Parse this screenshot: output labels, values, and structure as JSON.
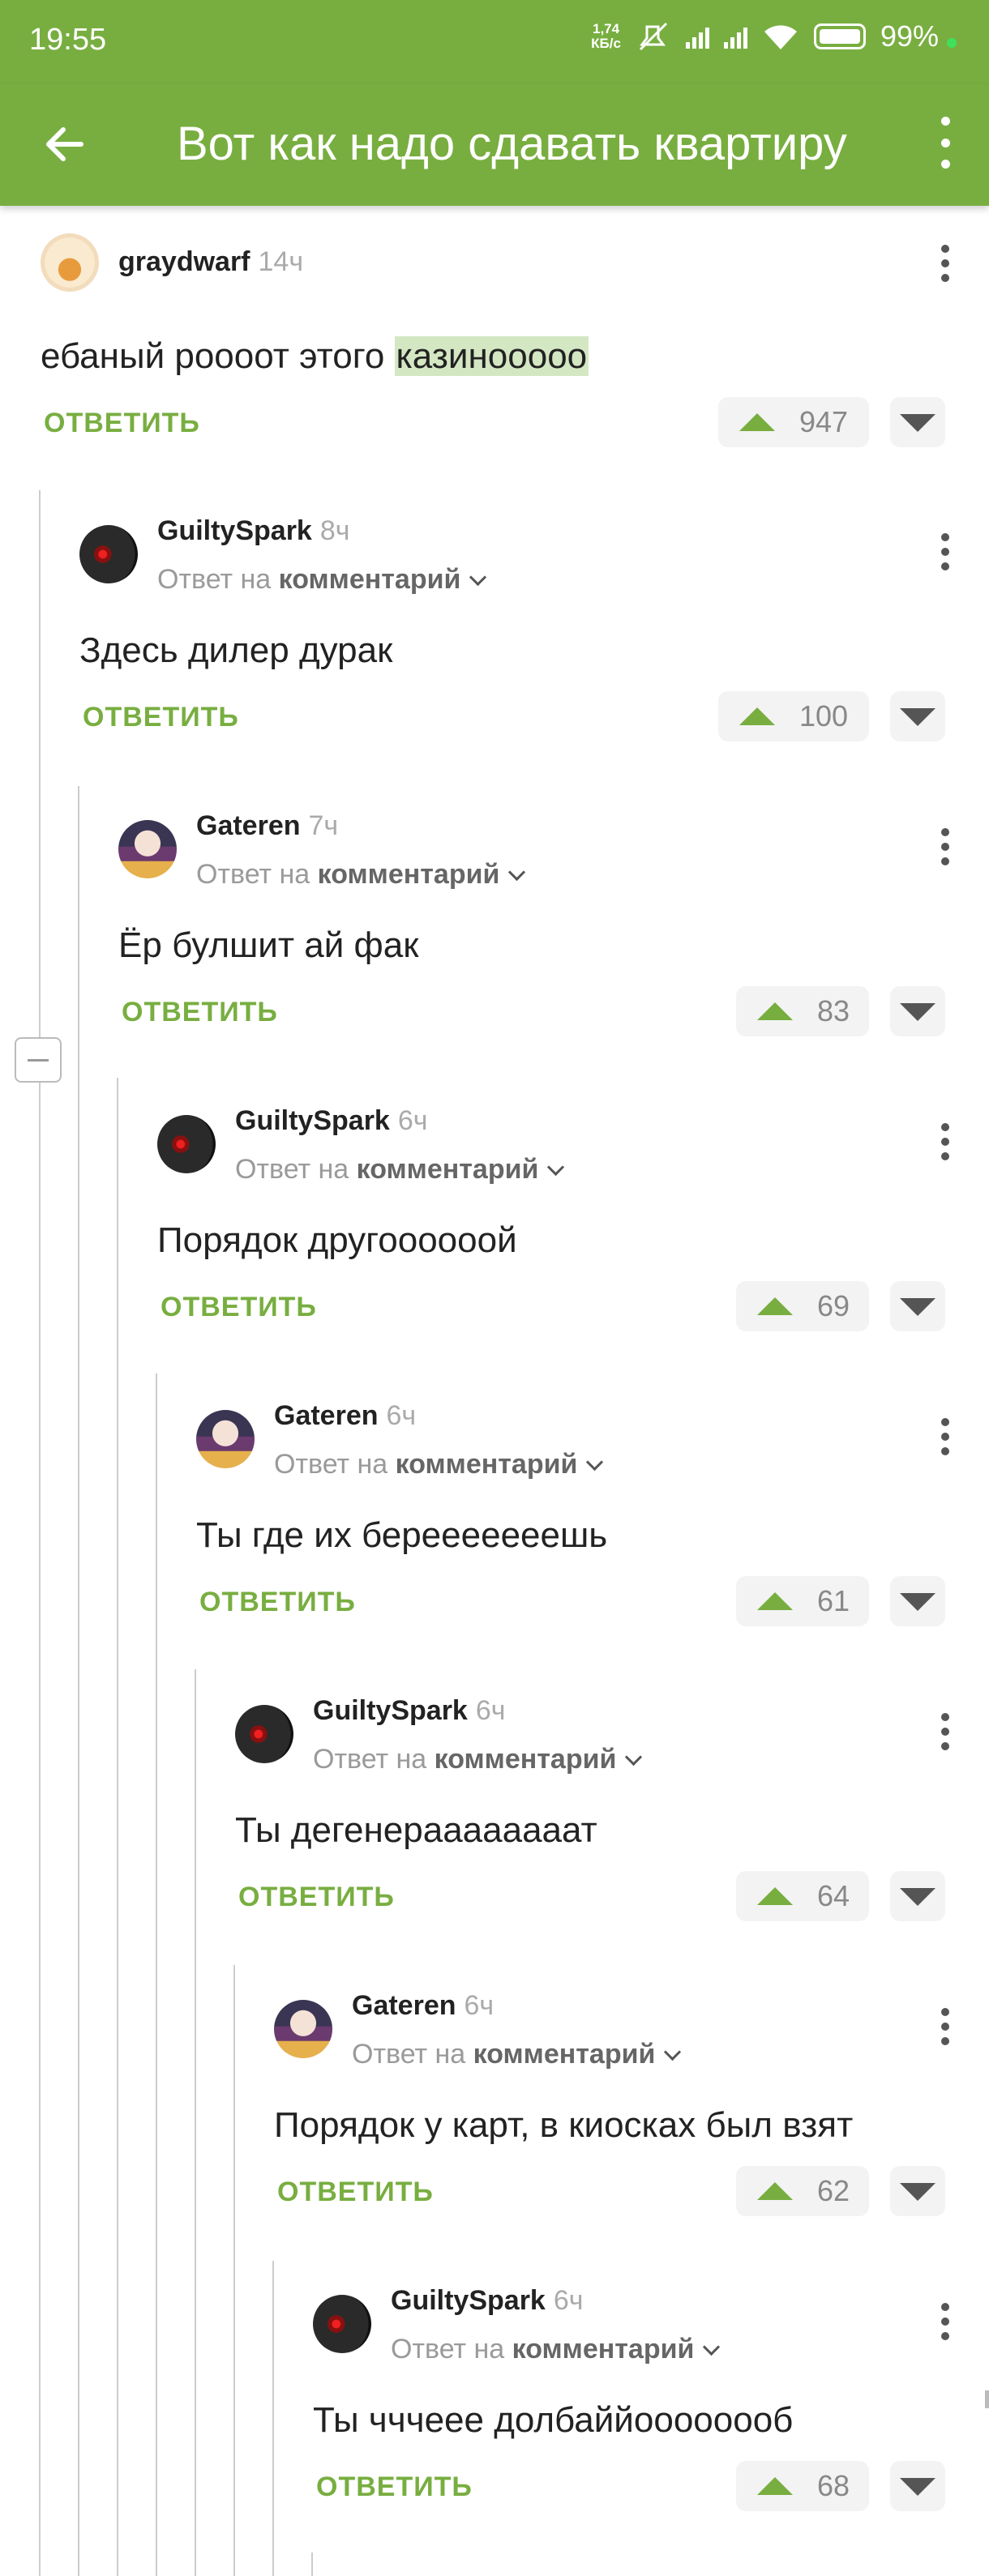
{
  "status": {
    "time": "19:55",
    "speed_value": "1,74",
    "speed_unit": "КБ/с",
    "battery": "99%"
  },
  "appbar": {
    "title": "Вот как надо сдавать квартиру"
  },
  "reply_label": "ОТВЕТИТЬ",
  "reply_to_prefix": "Ответ на",
  "reply_to_link": "комментарий",
  "comments": [
    {
      "user": "graydwarf",
      "time": "14ч",
      "text_before": "ебаный роооот этого ",
      "highlight": "казинооооо",
      "score": "947"
    },
    {
      "user": "GuiltySpark",
      "time": "8ч",
      "text": "Здесь дилер дурак",
      "score": "100"
    },
    {
      "user": "Gateren",
      "time": "7ч",
      "text": "Ёр булшит ай фак",
      "score": "83"
    },
    {
      "user": "GuiltySpark",
      "time": "6ч",
      "text": "Порядок другоооооой",
      "score": "69"
    },
    {
      "user": "Gateren",
      "time": "6ч",
      "text": "Ты где их берееееееешь",
      "score": "61"
    },
    {
      "user": "GuiltySpark",
      "time": "6ч",
      "text": "Ты дегенераааааааат",
      "score": "64"
    },
    {
      "user": "Gateren",
      "time": "6ч",
      "text": "Порядок у карт, в киосках был взят",
      "score": "62"
    },
    {
      "user": "GuiltySpark",
      "time": "6ч",
      "text": "Ты чччеее долбаййоооооооб",
      "score": "68"
    }
  ]
}
